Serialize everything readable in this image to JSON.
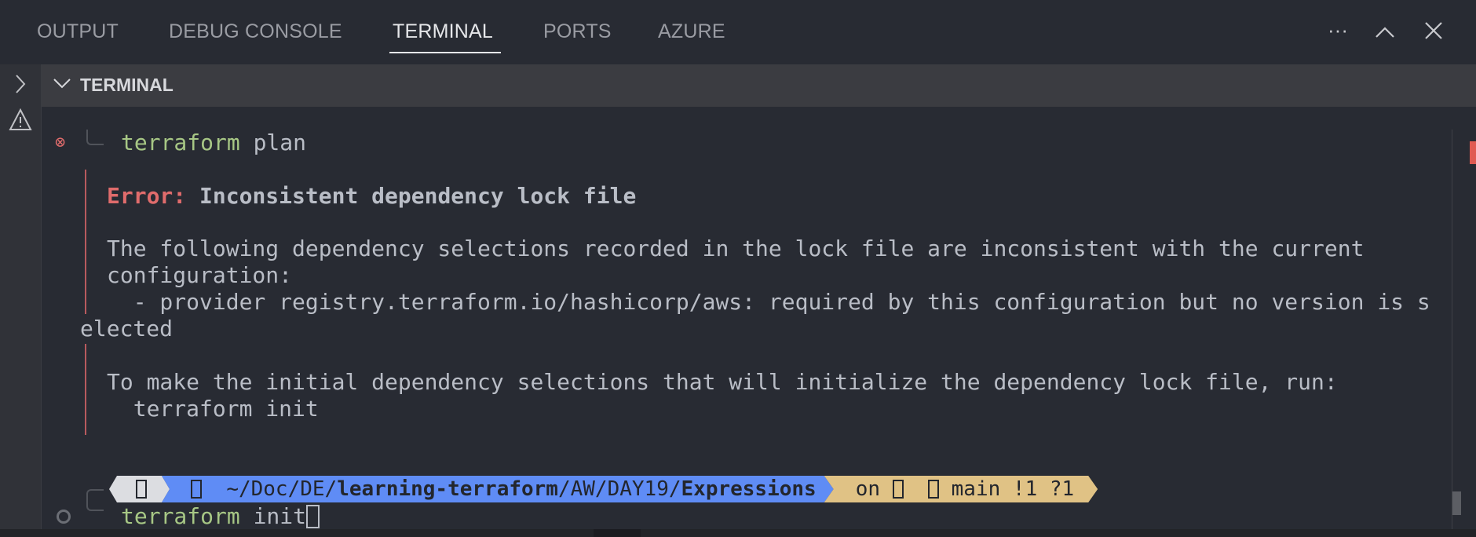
{
  "tabs": [
    {
      "label": "OUTPUT",
      "active": false
    },
    {
      "label": "DEBUG CONSOLE",
      "active": false
    },
    {
      "label": "TERMINAL",
      "active": true
    },
    {
      "label": "PORTS",
      "active": false
    },
    {
      "label": "AZURE",
      "active": false
    }
  ],
  "panel_actions": {
    "more": "more-actions-icon",
    "maximize": "chevron-up-icon",
    "close": "close-icon"
  },
  "section_header": {
    "title": "TERMINAL"
  },
  "terminal": {
    "command1": {
      "cmd": "terraform",
      "args": " plan",
      "status": "error"
    },
    "error_label": "Error:",
    "error_title": " Inconsistent dependency lock file",
    "lines": [
      "The following dependency selections recorded in the lock file are inconsistent with the current",
      "configuration:",
      "  - provider registry.terraform.io/hashicorp/aws: required by this configuration but no version is s",
      "elected",
      "To make the initial dependency selections that will initialize the dependency lock file, run:",
      "  terraform init"
    ],
    "prompt": {
      "path_prefix": "~/Doc/DE/",
      "path_repo": "learning-terraform",
      "path_mid": "/AW/DAY19/",
      "path_dir": "Expressions",
      "git_on": "on",
      "branch": "main",
      "git_status": "!1 ?1"
    },
    "command2": {
      "cmd": "terraform",
      "args": " init"
    }
  },
  "colors": {
    "background": "#282b33",
    "error": "#e06c6c",
    "command": "#a7c785",
    "path_segment": "#5f8cf5",
    "git_segment": "#e0c285"
  }
}
